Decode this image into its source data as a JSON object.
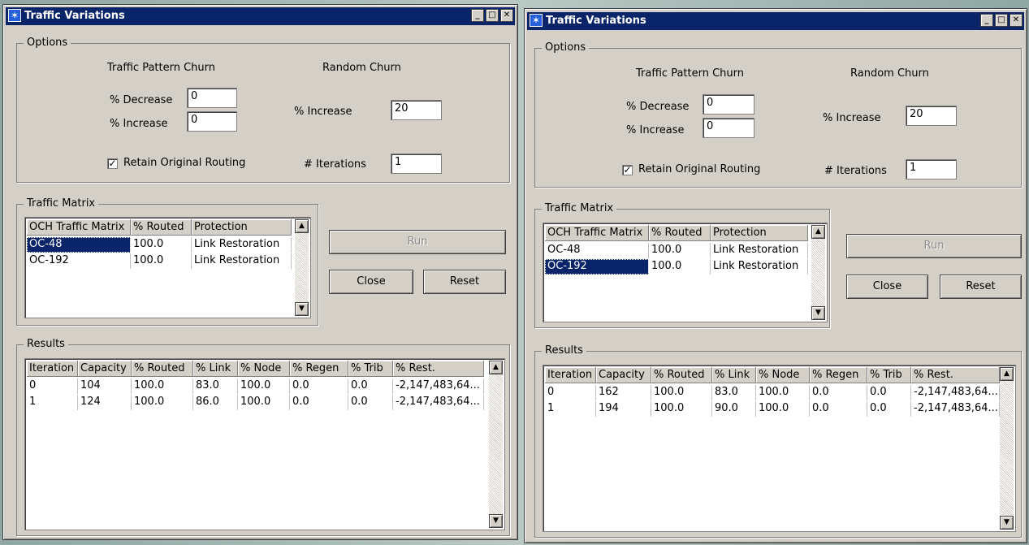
{
  "windows": [
    {
      "title": "Traffic Variations",
      "options": {
        "group_label": "Options",
        "tpc_heading": "Traffic Pattern Churn",
        "rc_heading": "Random Churn",
        "pct_decrease_label": "% Decrease",
        "pct_decrease_value": "0",
        "pct_increase_label": "% Increase",
        "pct_increase_value": "0",
        "rc_increase_label": "% Increase",
        "rc_increase_value": "20",
        "retain_label": "Retain Original Routing",
        "retain_checked": "✓",
        "iterations_label": "# Iterations",
        "iterations_value": "1"
      },
      "traffic_matrix": {
        "group_label": "Traffic Matrix",
        "headers": [
          "OCH Traffic Matrix",
          "% Routed",
          "Protection"
        ],
        "rows": [
          [
            "OC-48",
            "100.0",
            "Link Restoration"
          ],
          [
            "OC-192",
            "100.0",
            "Link Restoration"
          ]
        ]
      },
      "buttons": {
        "run": "Run",
        "close": "Close",
        "reset": "Reset"
      },
      "results": {
        "group_label": "Results",
        "headers": [
          "Iteration",
          "Capacity",
          "% Routed",
          "% Link",
          "% Node",
          "% Regen",
          "% Trib",
          "% Rest."
        ],
        "rows": [
          [
            "0",
            "104",
            "100.0",
            "83.0",
            "100.0",
            "0.0",
            "0.0",
            "-2,147,483,64..."
          ],
          [
            "1",
            "124",
            "100.0",
            "86.0",
            "100.0",
            "0.0",
            "0.0",
            "-2,147,483,64..."
          ]
        ]
      }
    },
    {
      "title": "Traffic Variations",
      "options": {
        "group_label": "Options",
        "tpc_heading": "Traffic Pattern Churn",
        "rc_heading": "Random Churn",
        "pct_decrease_label": "% Decrease",
        "pct_decrease_value": "0",
        "pct_increase_label": "% Increase",
        "pct_increase_value": "0",
        "rc_increase_label": "% Increase",
        "rc_increase_value": "20",
        "retain_label": "Retain Original Routing",
        "retain_checked": "✓",
        "iterations_label": "# Iterations",
        "iterations_value": "1"
      },
      "traffic_matrix": {
        "group_label": "Traffic Matrix",
        "headers": [
          "OCH Traffic Matrix",
          "% Routed",
          "Protection"
        ],
        "rows": [
          [
            "OC-48",
            "100.0",
            "Link Restoration"
          ],
          [
            "OC-192",
            "100.0",
            "Link Restoration"
          ]
        ]
      },
      "buttons": {
        "run": "Run",
        "close": "Close",
        "reset": "Reset"
      },
      "results": {
        "group_label": "Results",
        "headers": [
          "Iteration",
          "Capacity",
          "% Routed",
          "% Link",
          "% Node",
          "% Regen",
          "% Trib",
          "% Rest."
        ],
        "rows": [
          [
            "0",
            "162",
            "100.0",
            "83.0",
            "100.0",
            "0.0",
            "0.0",
            "-2,147,483,64..."
          ],
          [
            "1",
            "194",
            "100.0",
            "90.0",
            "100.0",
            "0.0",
            "0.0",
            "-2,147,483,64..."
          ]
        ]
      }
    }
  ]
}
